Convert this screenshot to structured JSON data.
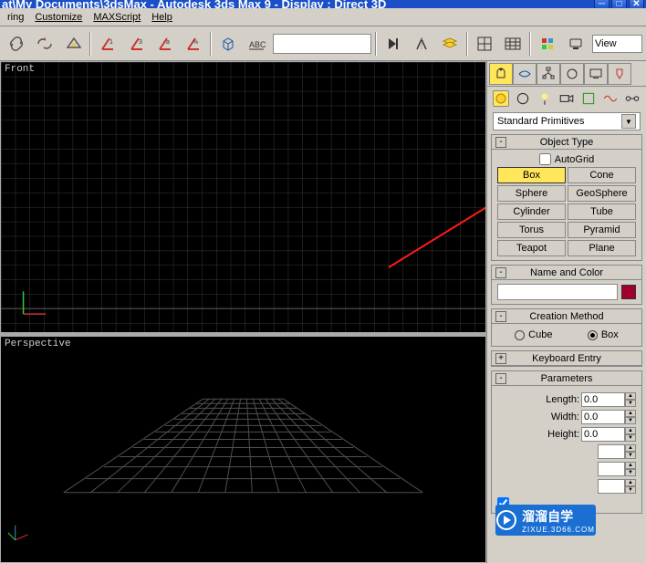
{
  "title": "at\\My Documents\\3dsMax      - Autodesk 3ds Max 9    - Display : Direct 3D",
  "menu": {
    "rendering": "ring",
    "customize": "Customize",
    "maxscript": "MAXScript",
    "help": "Help"
  },
  "toolbar": {
    "icons": {
      "undo": "undo-icon",
      "redo": "redo-icon",
      "link": "link-icon",
      "alpha1": "angle-one-icon",
      "alpha3": "angle-three-icon",
      "anglea": "anglea-icon",
      "percent": "anglepercent-icon",
      "cube": "cube-icon",
      "measure": "measure-icon",
      "play": "next-icon",
      "mirror": "mirror-icon",
      "layers": "layers-icon",
      "grid1": "grid-small-icon",
      "grid2": "grid-big-icon",
      "dots": "four-dots-icon",
      "monitor": "schematic-icon"
    },
    "dropdown": "",
    "view": "View"
  },
  "viewports": {
    "front": "Front",
    "perspective": "Perspective"
  },
  "panel_dd": "Standard Primitives",
  "rollouts": {
    "object_type": {
      "title": "Object Type",
      "autogrid": "AutoGrid",
      "buttons": [
        "Box",
        "Cone",
        "Sphere",
        "GeoSphere",
        "Cylinder",
        "Tube",
        "Torus",
        "Pyramid",
        "Teapot",
        "Plane"
      ]
    },
    "name_color": {
      "title": "Name and Color"
    },
    "creation": {
      "title": "Creation Method",
      "cube": "Cube",
      "box": "Box"
    },
    "keyboard": {
      "title": "Keyboard Entry"
    },
    "params": {
      "title": "Parameters",
      "length_lbl": "Length:",
      "length_val": "0.0",
      "width_lbl": "Width:",
      "width_val": "0.0",
      "height_lbl": "Height:",
      "height_val": "0.0"
    }
  },
  "watermark": {
    "text": "溜溜自学",
    "sub": "ZIXUE.3D66.COM"
  }
}
